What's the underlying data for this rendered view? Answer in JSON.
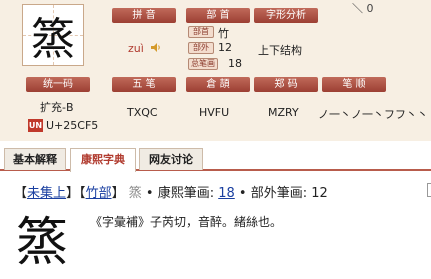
{
  "character": "篜",
  "top_icon": "＼ 0",
  "info_labels": {
    "pinyin": "拼 音",
    "bushou": "部 首",
    "zixing": "字形分析",
    "unicode": "统一码",
    "wubi": "五 笔",
    "cangjie": "倉 頡",
    "zhengma": "郑 码",
    "bishun": "笔 顺"
  },
  "pinyin": "zuì",
  "bushou": {
    "radical_label": "部首",
    "radical": "竹",
    "outer_label": "部外",
    "outer_strokes": "12",
    "total_label": "总笔画",
    "total_strokes": "18"
  },
  "structure": "上下结构",
  "unicode": {
    "block": "扩充-B",
    "logo": "UN",
    "code": "U+25CF5"
  },
  "wubi": "TXQC",
  "cangjie": "HVFU",
  "zhengma": "MZRY",
  "bishun": "ノ一丶ノ一丶フフ丶丶",
  "tabs": [
    "基本解释",
    "康熙字典",
    "网友讨论"
  ],
  "kangxi": {
    "open1": "【",
    "collection": "未集上",
    "close1": "】",
    "open2": "【",
    "radical": "竹部",
    "close2": "】",
    "variant": "篜",
    "strokes_label": "• 康熙筆画:",
    "strokes": "18",
    "outer_label": "• 部外筆画:",
    "outer": "12",
    "definition": "《字彙補》子芮切，音醉。緒絲也。"
  }
}
